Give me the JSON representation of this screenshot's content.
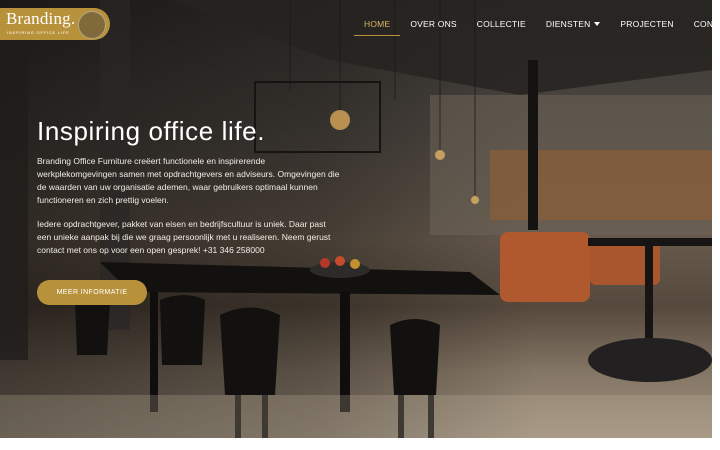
{
  "brand": {
    "name": "Branding.",
    "tagline": "INSPIRING OFFICE LIFE"
  },
  "nav": {
    "items": [
      {
        "label": "HOME",
        "active": true
      },
      {
        "label": "OVER ONS"
      },
      {
        "label": "COLLECTIE"
      },
      {
        "label": "DIENSTEN",
        "dropdown": true
      },
      {
        "label": "PROJECTEN"
      },
      {
        "label": "CONTACT"
      }
    ]
  },
  "hero": {
    "title": "Inspiring office life.",
    "paragraph1": "Branding Office Furniture creëert functionele en inspirerende werkplekomgevingen samen met opdrachtgevers en adviseurs. Omgevingen die de waarden van uw organisatie ademen, waar gebruikers optimaal kunnen functioneren en zich prettig voelen.",
    "paragraph2": "Iedere opdrachtgever, pakket van eisen en bedrijfscultuur is uniek. Daar past een unieke aanpak bij die we graag persoonlijk met u realiseren. Neem gerust contact met ons op voor een open gesprek! +31 346 258000",
    "cta_label": "MEER INFORMATIE"
  },
  "colors": {
    "accent": "#b8923a",
    "nav_active": "#d6b665",
    "text": "#ffffff"
  }
}
